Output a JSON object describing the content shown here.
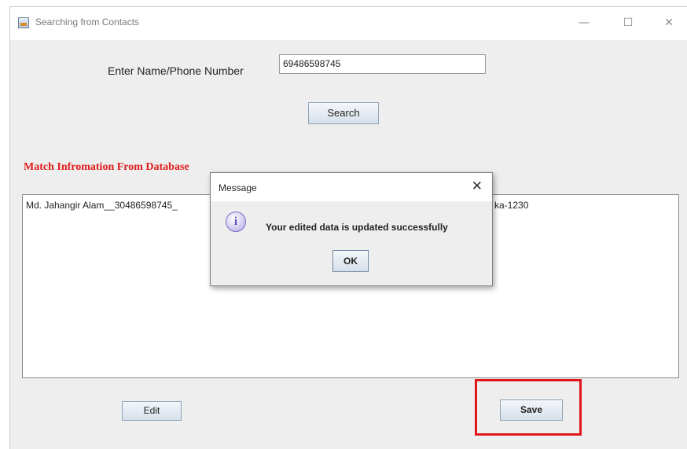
{
  "window": {
    "title": "Searching from Contacts",
    "minimize_glyph": "—",
    "maximize_glyph": "☐",
    "close_glyph": "✕"
  },
  "search": {
    "label": "Enter Name/Phone Number",
    "value": "69486598745",
    "button_label": "Search"
  },
  "results": {
    "heading": "Match Infromation From Database",
    "text_left": "Md. Jahangir Alam__30486598745_",
    "text_right": "ka-1230"
  },
  "actions": {
    "edit_label": "Edit",
    "save_label": "Save"
  },
  "dialog": {
    "title": "Message",
    "close_glyph": "✕",
    "icon": "info-icon",
    "icon_glyph": "i",
    "message": "Your edited data is updated successfully",
    "ok_label": "OK"
  },
  "colors": {
    "heading_red": "#e01b1b",
    "highlight_red": "#e0161b",
    "info_icon_purple": "#7c71c4"
  }
}
